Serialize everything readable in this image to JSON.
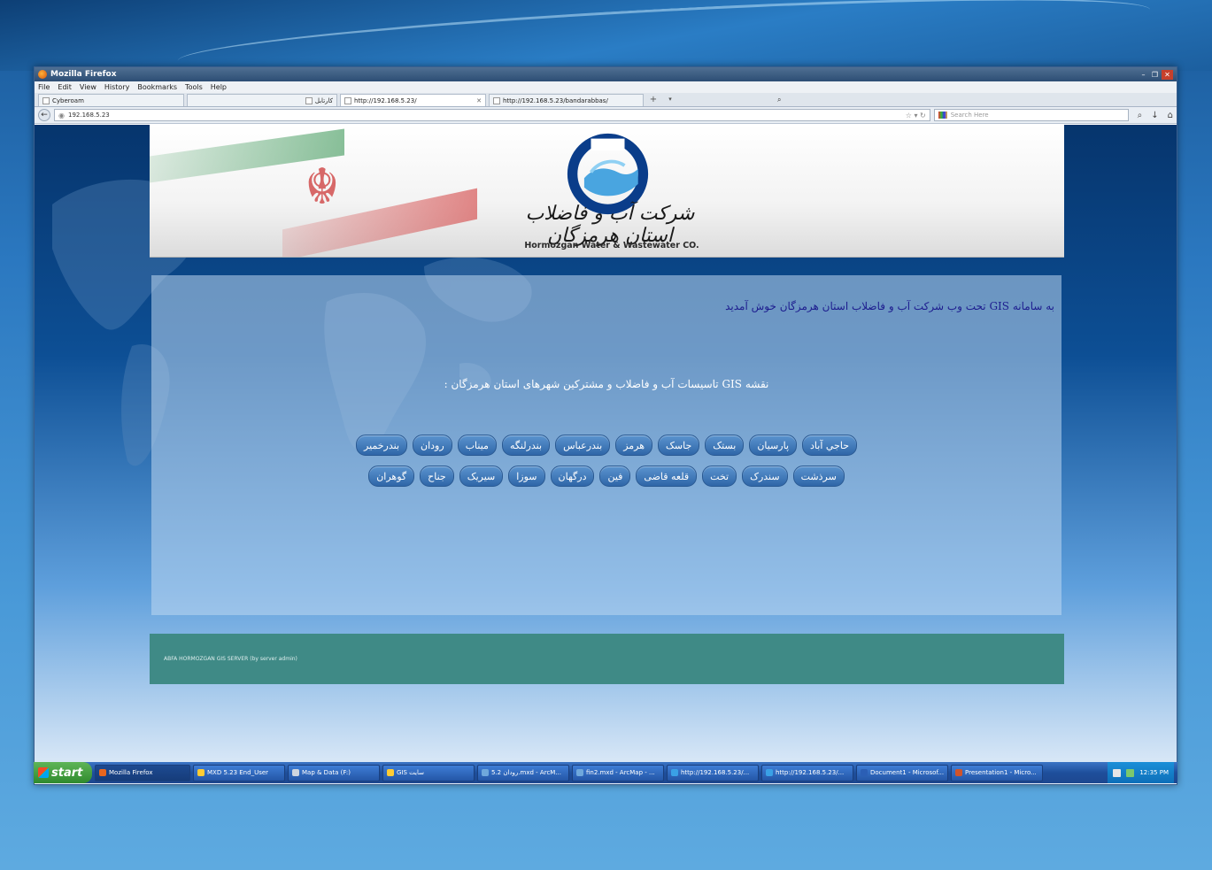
{
  "window": {
    "title": "Mozilla Firefox"
  },
  "menu": [
    "File",
    "Edit",
    "View",
    "History",
    "Bookmarks",
    "Tools",
    "Help"
  ],
  "tabs": [
    {
      "label": "Cyberoam",
      "active": false
    },
    {
      "label": "کارتابل",
      "active": false
    },
    {
      "label": "http://192.168.5.23/",
      "active": true
    },
    {
      "label": "http://192.168.5.23/bandarabbas/",
      "active": false
    }
  ],
  "nav": {
    "url": "192.168.5.23",
    "search_placeholder": "Search Here"
  },
  "banner": {
    "company_fa": "شرکت آب و فاضلاب استان هرمزگان",
    "company_en": "Hormozgan Water & Wastewater CO."
  },
  "content": {
    "welcome": "به سامانه GIS تحت وب شرکت آب و فاضلاب استان هرمزگان خوش آمدید",
    "map_title": "نقشه GIS تاسیسات آب و فاضلاب و مشترکین شهرهای استان هرمزگان :",
    "cities_row1": [
      "حاجي آباد",
      "پارسیان",
      "بستک",
      "جاسک",
      "هرمز",
      "بندرعباس",
      "بندرلنگه",
      "میناب",
      "رودان",
      "بندرخمیر"
    ],
    "cities_row2": [
      "سرذشت",
      "سندرک",
      "تخت",
      "قلعه قاضی",
      "فین",
      "درگهان",
      "سوزا",
      "سیریک",
      "جناح",
      "گوهران"
    ]
  },
  "footer": {
    "text": "ABFA HORMOZGAN GIS SERVER (by server admin)"
  },
  "taskbar": {
    "start": "start",
    "items": [
      "Mozilla Firefox",
      "MXD 5.23 End_User",
      "Map & Data (F:)",
      "GIS سایت",
      "5.2 رودان.mxd - ArcM...",
      "fin2.mxd - ArcMap - ...",
      "http://192.168.5.23/...",
      "http://192.168.5.23/...",
      "Document1 - Microsof...",
      "Presentation1 - Micro..."
    ],
    "clock": "12:35 PM"
  },
  "colors": {
    "button_blue": "#2f66a8",
    "footer_teal": "#3f8a86",
    "welcome_text": "#1d1d8f"
  }
}
